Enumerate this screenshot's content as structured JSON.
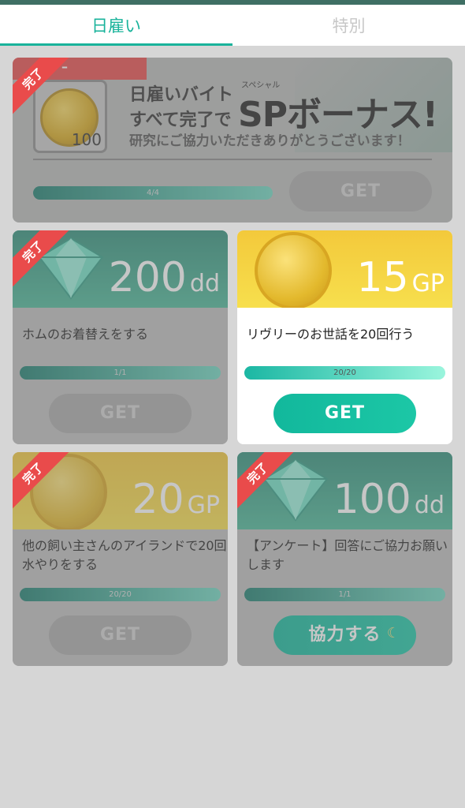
{
  "tabs": [
    {
      "label": "日雇い",
      "active": true
    },
    {
      "label": "特別",
      "active": false
    }
  ],
  "bonus": {
    "status": "完了",
    "status_dash": "–",
    "coin_count": "100",
    "title_line1": "日雇いバイト",
    "title_line2": "すべて完了で",
    "ruby": "スペシャル",
    "headline": "SPボーナス!",
    "subtitle": "研究にご協力いただきありがとうございます！",
    "progress_text": "4/4",
    "progress": 1.0,
    "button": "GET"
  },
  "cards": [
    {
      "status": "完了",
      "reward_value": "200",
      "reward_unit": "dd",
      "title": "ホムのお着替えをする",
      "progress_text": "1/1",
      "progress": 1.0,
      "button": "GET",
      "button_enabled": false
    },
    {
      "status": "",
      "reward_value": "15",
      "reward_unit": "GP",
      "title": "リヴリーのお世話を20回行う",
      "progress_text": "20/20",
      "progress": 1.0,
      "button": "GET",
      "button_enabled": true
    },
    {
      "status": "完了",
      "reward_value": "20",
      "reward_unit": "GP",
      "title": "他の飼い主さんのアイランドで20回水やりをする",
      "progress_text": "20/20",
      "progress": 1.0,
      "button": "GET",
      "button_enabled": false
    },
    {
      "status": "完了",
      "reward_value": "100",
      "reward_unit": "dd",
      "title": "【アンケート】回答にご協力お願いします",
      "progress_text": "1/1",
      "progress": 1.0,
      "button": "協力する",
      "button_enabled": true
    }
  ],
  "colors": {
    "accent": "#19b39b",
    "ribbon": "#e94b4b",
    "teal_header": "#2e8f7a",
    "gold_header": "#f3c93b"
  },
  "icons": [
    "diamond-icon",
    "gp-coin-icon",
    "moon-icon"
  ]
}
